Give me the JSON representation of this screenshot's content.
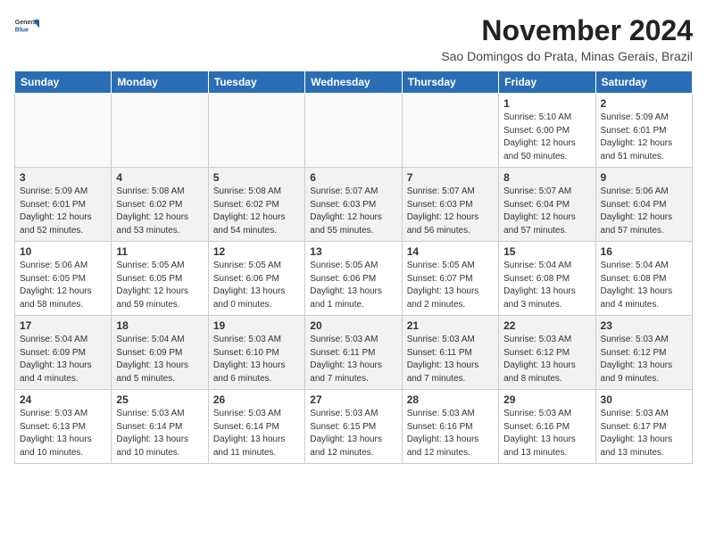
{
  "header": {
    "logo": {
      "line1": "General",
      "line2": "Blue"
    },
    "title": "November 2024",
    "location": "Sao Domingos do Prata, Minas Gerais, Brazil"
  },
  "weekdays": [
    "Sunday",
    "Monday",
    "Tuesday",
    "Wednesday",
    "Thursday",
    "Friday",
    "Saturday"
  ],
  "weeks": [
    [
      {
        "day": "",
        "info": ""
      },
      {
        "day": "",
        "info": ""
      },
      {
        "day": "",
        "info": ""
      },
      {
        "day": "",
        "info": ""
      },
      {
        "day": "",
        "info": ""
      },
      {
        "day": "1",
        "info": "Sunrise: 5:10 AM\nSunset: 6:00 PM\nDaylight: 12 hours\nand 50 minutes."
      },
      {
        "day": "2",
        "info": "Sunrise: 5:09 AM\nSunset: 6:01 PM\nDaylight: 12 hours\nand 51 minutes."
      }
    ],
    [
      {
        "day": "3",
        "info": "Sunrise: 5:09 AM\nSunset: 6:01 PM\nDaylight: 12 hours\nand 52 minutes."
      },
      {
        "day": "4",
        "info": "Sunrise: 5:08 AM\nSunset: 6:02 PM\nDaylight: 12 hours\nand 53 minutes."
      },
      {
        "day": "5",
        "info": "Sunrise: 5:08 AM\nSunset: 6:02 PM\nDaylight: 12 hours\nand 54 minutes."
      },
      {
        "day": "6",
        "info": "Sunrise: 5:07 AM\nSunset: 6:03 PM\nDaylight: 12 hours\nand 55 minutes."
      },
      {
        "day": "7",
        "info": "Sunrise: 5:07 AM\nSunset: 6:03 PM\nDaylight: 12 hours\nand 56 minutes."
      },
      {
        "day": "8",
        "info": "Sunrise: 5:07 AM\nSunset: 6:04 PM\nDaylight: 12 hours\nand 57 minutes."
      },
      {
        "day": "9",
        "info": "Sunrise: 5:06 AM\nSunset: 6:04 PM\nDaylight: 12 hours\nand 57 minutes."
      }
    ],
    [
      {
        "day": "10",
        "info": "Sunrise: 5:06 AM\nSunset: 6:05 PM\nDaylight: 12 hours\nand 58 minutes."
      },
      {
        "day": "11",
        "info": "Sunrise: 5:05 AM\nSunset: 6:05 PM\nDaylight: 12 hours\nand 59 minutes."
      },
      {
        "day": "12",
        "info": "Sunrise: 5:05 AM\nSunset: 6:06 PM\nDaylight: 13 hours\nand 0 minutes."
      },
      {
        "day": "13",
        "info": "Sunrise: 5:05 AM\nSunset: 6:06 PM\nDaylight: 13 hours\nand 1 minute."
      },
      {
        "day": "14",
        "info": "Sunrise: 5:05 AM\nSunset: 6:07 PM\nDaylight: 13 hours\nand 2 minutes."
      },
      {
        "day": "15",
        "info": "Sunrise: 5:04 AM\nSunset: 6:08 PM\nDaylight: 13 hours\nand 3 minutes."
      },
      {
        "day": "16",
        "info": "Sunrise: 5:04 AM\nSunset: 6:08 PM\nDaylight: 13 hours\nand 4 minutes."
      }
    ],
    [
      {
        "day": "17",
        "info": "Sunrise: 5:04 AM\nSunset: 6:09 PM\nDaylight: 13 hours\nand 4 minutes."
      },
      {
        "day": "18",
        "info": "Sunrise: 5:04 AM\nSunset: 6:09 PM\nDaylight: 13 hours\nand 5 minutes."
      },
      {
        "day": "19",
        "info": "Sunrise: 5:03 AM\nSunset: 6:10 PM\nDaylight: 13 hours\nand 6 minutes."
      },
      {
        "day": "20",
        "info": "Sunrise: 5:03 AM\nSunset: 6:11 PM\nDaylight: 13 hours\nand 7 minutes."
      },
      {
        "day": "21",
        "info": "Sunrise: 5:03 AM\nSunset: 6:11 PM\nDaylight: 13 hours\nand 7 minutes."
      },
      {
        "day": "22",
        "info": "Sunrise: 5:03 AM\nSunset: 6:12 PM\nDaylight: 13 hours\nand 8 minutes."
      },
      {
        "day": "23",
        "info": "Sunrise: 5:03 AM\nSunset: 6:12 PM\nDaylight: 13 hours\nand 9 minutes."
      }
    ],
    [
      {
        "day": "24",
        "info": "Sunrise: 5:03 AM\nSunset: 6:13 PM\nDaylight: 13 hours\nand 10 minutes."
      },
      {
        "day": "25",
        "info": "Sunrise: 5:03 AM\nSunset: 6:14 PM\nDaylight: 13 hours\nand 10 minutes."
      },
      {
        "day": "26",
        "info": "Sunrise: 5:03 AM\nSunset: 6:14 PM\nDaylight: 13 hours\nand 11 minutes."
      },
      {
        "day": "27",
        "info": "Sunrise: 5:03 AM\nSunset: 6:15 PM\nDaylight: 13 hours\nand 12 minutes."
      },
      {
        "day": "28",
        "info": "Sunrise: 5:03 AM\nSunset: 6:16 PM\nDaylight: 13 hours\nand 12 minutes."
      },
      {
        "day": "29",
        "info": "Sunrise: 5:03 AM\nSunset: 6:16 PM\nDaylight: 13 hours\nand 13 minutes."
      },
      {
        "day": "30",
        "info": "Sunrise: 5:03 AM\nSunset: 6:17 PM\nDaylight: 13 hours\nand 13 minutes."
      }
    ]
  ]
}
